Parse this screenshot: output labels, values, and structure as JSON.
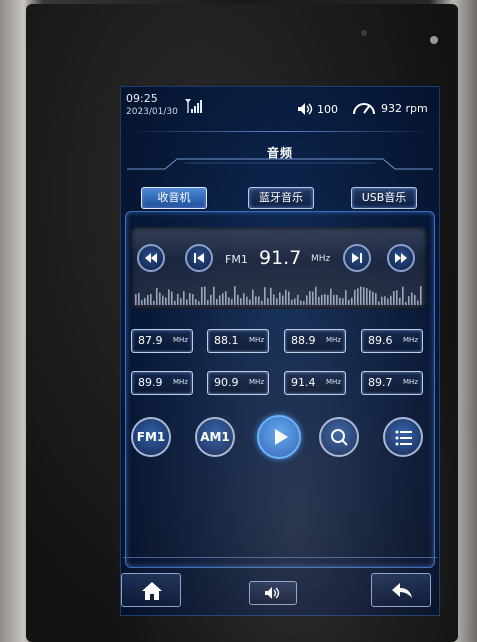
{
  "status_bar": {
    "time": "09:25",
    "date": "2023/01/30",
    "volume": "100",
    "rpm": "932 rpm",
    "icons": [
      "signal-icon",
      "speaker-icon",
      "speedometer-icon"
    ]
  },
  "page_title": "音频",
  "tabs": [
    {
      "label": "收音机",
      "active": true
    },
    {
      "label": "蓝牙音乐",
      "active": false
    },
    {
      "label": "USB音乐",
      "active": false
    }
  ],
  "tuner": {
    "band": "FM1",
    "frequency": "91.7",
    "unit": "MHz",
    "buttons": [
      "rewind-icon",
      "previous-icon",
      "next-icon",
      "fast-forward-icon"
    ]
  },
  "presets": [
    {
      "freq": "87.9",
      "unit": "MHz"
    },
    {
      "freq": "88.1",
      "unit": "MHz"
    },
    {
      "freq": "88.9",
      "unit": "MHz"
    },
    {
      "freq": "89.6",
      "unit": "MHz"
    },
    {
      "freq": "89.9",
      "unit": "MHz"
    },
    {
      "freq": "90.9",
      "unit": "MHz"
    },
    {
      "freq": "91.4",
      "unit": "MHz"
    },
    {
      "freq": "89.7",
      "unit": "MHz"
    }
  ],
  "controls": {
    "fm": "FM1",
    "am": "AM1",
    "icons": [
      "play-icon",
      "search-icon",
      "list-icon"
    ]
  },
  "nav": {
    "icons": [
      "home-icon",
      "speaker-icon",
      "back-icon"
    ]
  },
  "colors": {
    "screen_bg": "#081a3a",
    "accent": "#3e8df0",
    "active_tab": "#4a8ad8"
  }
}
